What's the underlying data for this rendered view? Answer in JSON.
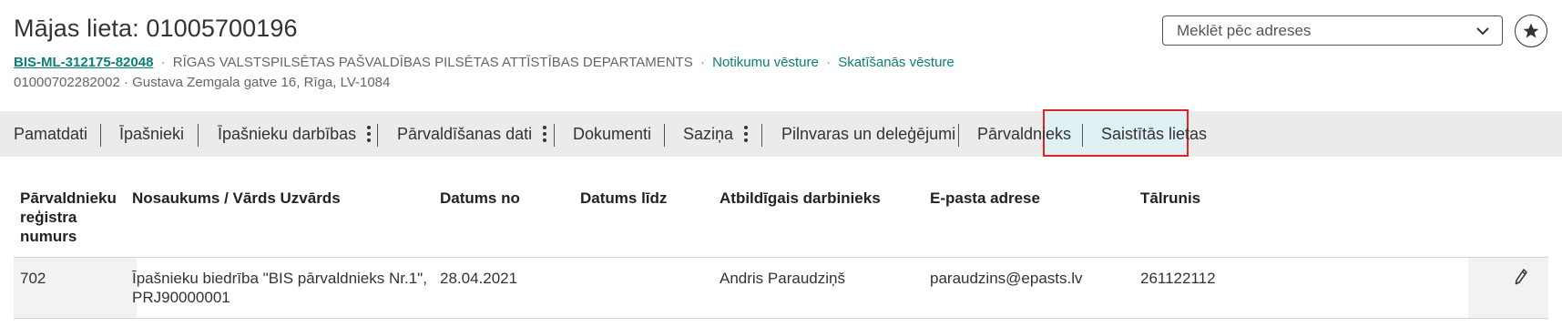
{
  "header": {
    "title": "Mājas lieta: 01005700196",
    "case_id": "BIS-ML-312175-82048",
    "department": "RĪGAS VALSTSPILSĒTAS PAŠVALDĪBAS PILSĒTAS ATTĪSTĪBAS DEPARTAMENTS",
    "event_history_link": "Notikumu vēsture",
    "view_history_link": "Skatīšanās vēsture",
    "separator": "·",
    "cadastre": "01000702282002",
    "address": "Gustava Zemgala gatve 16, Rīga, LV-1084"
  },
  "search": {
    "placeholder": "Meklēt pēc adreses",
    "icon": "chevron-down-icon"
  },
  "favorite": {
    "icon": "star-icon"
  },
  "tabs": [
    {
      "label": "Pamatdati",
      "has_menu": false
    },
    {
      "label": "Īpašnieki",
      "has_menu": false
    },
    {
      "label": "Īpašnieku darbības",
      "has_menu": true
    },
    {
      "label": "Pārvaldīšanas dati",
      "has_menu": true
    },
    {
      "label": "Dokumenti",
      "has_menu": false
    },
    {
      "label": "Saziņa",
      "has_menu": true
    },
    {
      "label": "Pilnvaras un deleģējumi",
      "has_menu": false
    },
    {
      "label": "Pārvaldnieks",
      "has_menu": false,
      "active": true
    },
    {
      "label": "Saistītās lietas",
      "has_menu": false
    }
  ],
  "table": {
    "columns": [
      "Pārvaldnieku\nreģistra\nnumurs",
      "Nosaukums / Vārds Uzvārds",
      "Datums no",
      "Datums līdz",
      "Atbildīgais darbinieks",
      "E-pasta adrese",
      "Tālrunis"
    ],
    "rows": [
      {
        "reg_no": "702",
        "name": "Īpašnieku biedrība \"BIS pārvaldnieks Nr.1\",\nPRJ90000001",
        "date_from": "28.04.2021",
        "date_to": "",
        "employee": "Andris Paraudziņš",
        "email": "paraudzins@epasts.lv",
        "phone": "261122112"
      }
    ]
  },
  "colors": {
    "accent": "#0b7f79",
    "active_tab_bg": "#dff1f3",
    "highlight_border": "#e02424",
    "tabbar_bg": "#ebebeb"
  }
}
